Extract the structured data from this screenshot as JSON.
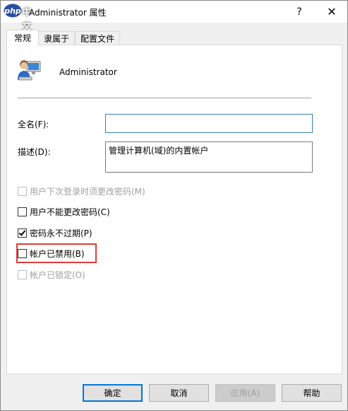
{
  "window": {
    "logo_text": "php中文网",
    "title": "Administrator 属性",
    "help_glyph": "?",
    "close_glyph": "✕"
  },
  "tabs": [
    {
      "label": "常规",
      "active": true
    },
    {
      "label": "隶属于",
      "active": false
    },
    {
      "label": "配置文件",
      "active": false
    }
  ],
  "user": {
    "name": "Administrator",
    "icon": "user-account-icon"
  },
  "fields": {
    "fullname_label": "全名(F):",
    "fullname_value": "",
    "description_label": "描述(D):",
    "description_value": "管理计算机(域)的内置帐户"
  },
  "checkboxes": [
    {
      "label": "用户下次登录时须更改密码(M)",
      "checked": false,
      "disabled": true
    },
    {
      "label": "用户不能更改密码(C)",
      "checked": false,
      "disabled": false
    },
    {
      "label": "密码永不过期(P)",
      "checked": true,
      "disabled": false
    },
    {
      "label": "帐户已禁用(B)",
      "checked": false,
      "disabled": false,
      "highlighted": true
    },
    {
      "label": "帐户已锁定(O)",
      "checked": false,
      "disabled": true
    }
  ],
  "buttons": {
    "ok": "确定",
    "cancel": "取消",
    "apply": "应用(A)",
    "help": "帮助"
  },
  "colors": {
    "accent": "#0078d7",
    "highlight": "#e03c3c"
  }
}
